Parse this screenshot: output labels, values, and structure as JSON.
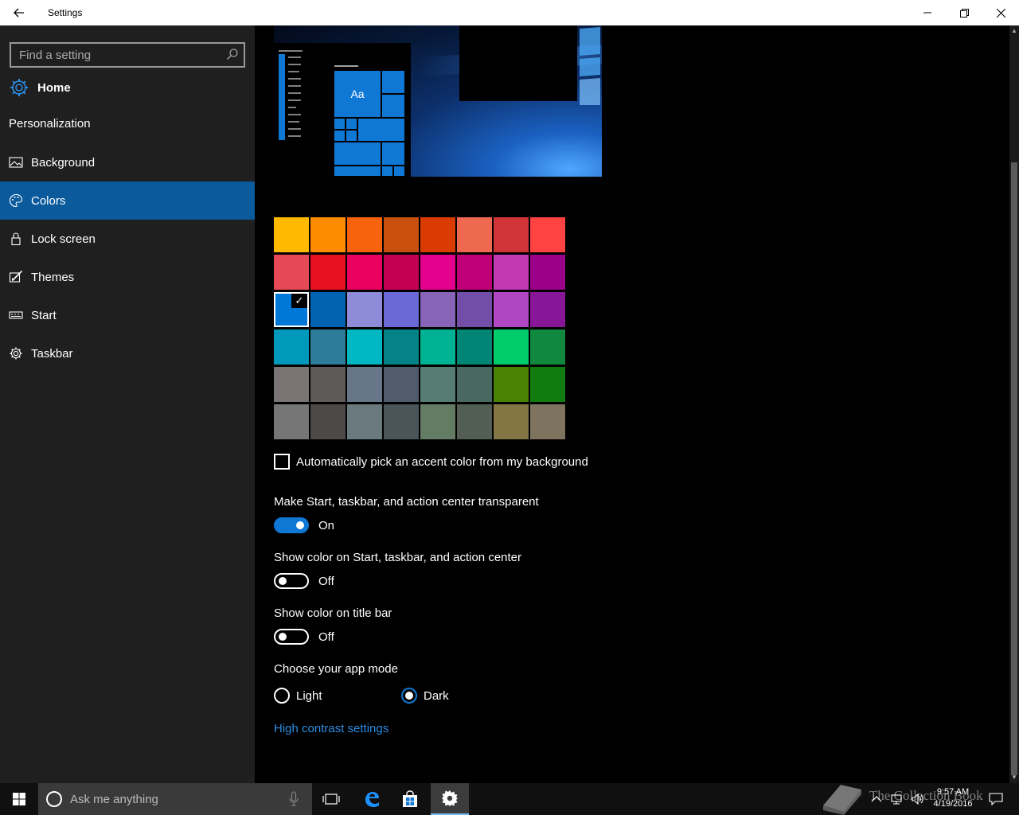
{
  "window": {
    "title": "Settings"
  },
  "sidebar": {
    "search_placeholder": "Find a setting",
    "home_label": "Home",
    "section_title": "Personalization",
    "items": [
      {
        "label": "Background",
        "icon": "picture-icon"
      },
      {
        "label": "Colors",
        "icon": "palette-icon",
        "active": true
      },
      {
        "label": "Lock screen",
        "icon": "lock-icon"
      },
      {
        "label": "Themes",
        "icon": "brush-icon"
      },
      {
        "label": "Start",
        "icon": "start-list-icon"
      },
      {
        "label": "Taskbar",
        "icon": "taskbar-gear-icon"
      }
    ]
  },
  "preview": {
    "tile_text": "Aa"
  },
  "accent_colors": {
    "selected_index": 16,
    "rows": [
      [
        "#FFB900",
        "#FF8C00",
        "#F7630C",
        "#CA5010",
        "#DA3B01",
        "#EF6950",
        "#D13438",
        "#FF4343"
      ],
      [
        "#E74856",
        "#E81123",
        "#EA005E",
        "#C30052",
        "#E3008C",
        "#BF0077",
        "#C239B3",
        "#9A0089"
      ],
      [
        "#0078D7",
        "#0063B1",
        "#8E8CD8",
        "#6B69D6",
        "#8764B8",
        "#744DA9",
        "#B146C2",
        "#881798"
      ],
      [
        "#0099BC",
        "#2D7D9A",
        "#00B7C3",
        "#038387",
        "#00B294",
        "#018574",
        "#00CC6A",
        "#10893E"
      ],
      [
        "#7A7574",
        "#5D5A58",
        "#68768A",
        "#515C6B",
        "#567C73",
        "#486860",
        "#498205",
        "#107C10"
      ],
      [
        "#767676",
        "#4C4A48",
        "#69797E",
        "#4A5459",
        "#647C64",
        "#525E54",
        "#847545",
        "#7E735F"
      ]
    ]
  },
  "settings": {
    "auto_pick_label": "Automatically pick an accent color from my background",
    "auto_pick_checked": false,
    "transparent_label": "Make Start, taskbar, and action center transparent",
    "transparent_state": "On",
    "show_color_start_label": "Show color on Start, taskbar, and action center",
    "show_color_start_state": "Off",
    "show_color_title_label": "Show color on title bar",
    "show_color_title_state": "Off",
    "app_mode_label": "Choose your app mode",
    "app_mode_options": [
      "Light",
      "Dark"
    ],
    "app_mode_selected": "Dark",
    "high_contrast_link": "High contrast settings"
  },
  "taskbar": {
    "search_placeholder": "Ask me anything",
    "clock_time": "9:57 AM",
    "clock_date": "4/19/2016",
    "watermark_text": "The Collection Book"
  },
  "colors": {
    "accent": "#0F78D4",
    "sidebar_bg": "#1F1F1F",
    "active_nav": "#0A5A9C",
    "link": "#2B8DE3"
  }
}
